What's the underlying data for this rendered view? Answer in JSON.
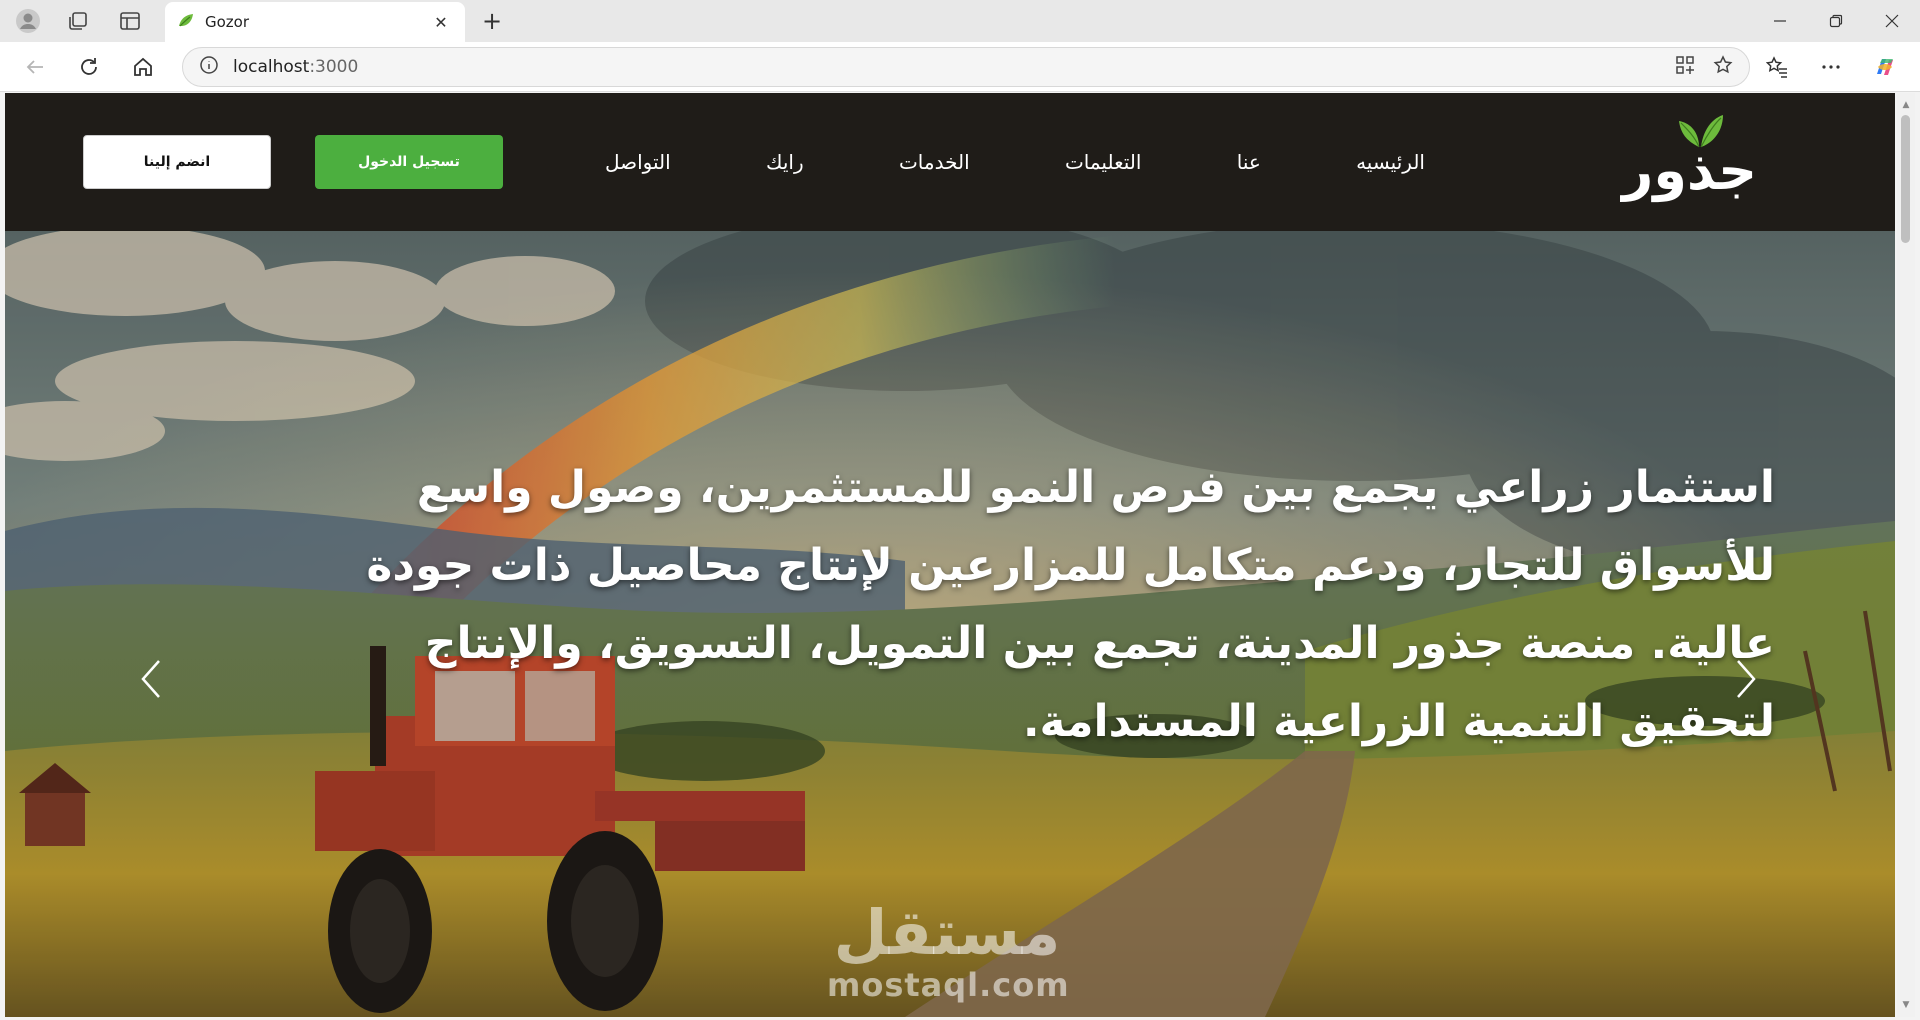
{
  "browser": {
    "tab_title": "Gozor",
    "url_host": "localhost",
    "url_port": ":3000"
  },
  "site": {
    "logo_text": "جذور",
    "nav": [
      {
        "label": "الرئيسيه"
      },
      {
        "label": "عنا"
      },
      {
        "label": "التعليمات"
      },
      {
        "label": "الخدمات"
      },
      {
        "label": "رايك"
      },
      {
        "label": "التواصل"
      }
    ],
    "login_label": "تسجيل الدخول",
    "join_label": "انضم إلينا"
  },
  "hero": {
    "text": "استثمار زراعي يجمع بين فرص النمو للمستثمرين، وصول واسع للأسواق للتجار، ودعم متكامل للمزارعين لإنتاج محاصيل ذات جودة عالية. منصة جذور المدينة، تجمع بين التمويل، التسويق، والإنتاج لتحقيق التنمية الزراعية المستدامة."
  },
  "watermark": {
    "arabic": "مستقل",
    "latin": "mostaql.com"
  },
  "colors": {
    "header_bg": "#1f1c18",
    "login_button": "#4caf3f",
    "join_button": "#ffffff",
    "logo_leaf": "#6dbb3c"
  },
  "icons": {
    "profile": "profile-icon",
    "workspaces": "workspaces-icon",
    "tab_actions": "tab-actions-icon",
    "favicon": "leaf-favicon-icon",
    "back": "back-arrow-icon",
    "refresh": "refresh-icon",
    "home": "home-icon",
    "site_info": "info-icon",
    "app_available": "apps-icon",
    "favorite": "star-icon",
    "favorites": "favorites-icon",
    "more": "more-icon",
    "copilot": "copilot-icon"
  }
}
